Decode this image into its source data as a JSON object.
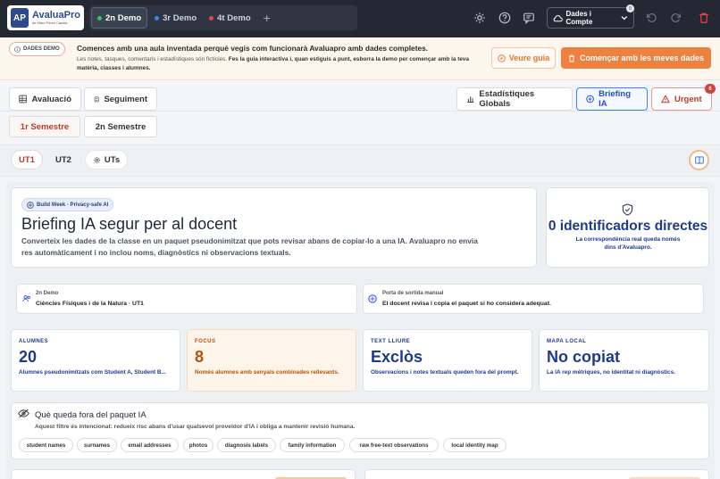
{
  "app": {
    "logo_name": "AvaluaPro",
    "logo_sub": "de Marc Pérez Casals",
    "logo_mark": "AP"
  },
  "demo_tabs": [
    {
      "label": "2n Demo",
      "color": "#34c46a",
      "active": true
    },
    {
      "label": "3r Demo",
      "color": "#3b82f6",
      "active": false
    },
    {
      "label": "4t Demo",
      "color": "#ef4444",
      "active": false
    }
  ],
  "topbar": {
    "account_label": "Dades i Compte",
    "account_badge": "0"
  },
  "banner": {
    "pill": "DADES DEMO",
    "title": "Comences amb una aula inventada perquè vegis com funcionarà Avaluapro amb dades completes.",
    "text_before": "Les notes, tasques, comentaris i estadístiques són fictícies. ",
    "text_bold": "Fes la guia interactiva i, quan estiguis a punt, esborra la demo per començar amb la teva matèria, classes i alumnes.",
    "guide_label": "Veure guia",
    "start_label": "Començar amb les meves dades"
  },
  "section_tabs": {
    "avaluacio": "Avaluació",
    "seguiment": "Seguiment",
    "estadistiques": "Estadístiques Globals",
    "briefing": "Briefing IA",
    "urgent": "Urgent",
    "urgent_count": "6"
  },
  "semesters": [
    "1r Semestre",
    "2n Semestre"
  ],
  "units": {
    "ut1": "UT1",
    "ut2": "UT2",
    "uts": "UTs"
  },
  "briefing": {
    "pill": "Build Week · Privacy-safe AI",
    "title": "Briefing IA segur per al docent",
    "subtitle": "Converteix les dades de la classe en un paquet pseudonimitzat que pots revisar abans de copiar-lo a una IA. Avaluapro no envia res automàticament i no inclou noms, diagnòstics ni observacions textuals.",
    "zero_value": "0 identificadors directes",
    "zero_sub": "La correspondència real queda només dins d'Avaluapro."
  },
  "context": {
    "class_small": "2n Demo",
    "class_main": "Ciències Físiques i de la Natura · UT1",
    "gate_small": "Porta de sortida manual",
    "gate_main": "El docent revisa i copia el paquet si ho considera adequat."
  },
  "stats": [
    {
      "label": "ALUMNES",
      "value": "20",
      "desc": "Alumnes pseudonimitzats com Student A, Student B..."
    },
    {
      "label": "FOCUS",
      "value": "8",
      "desc": "Només alumnes amb senyals combinades rellevants."
    },
    {
      "label": "TEXT LLIURE",
      "value": "Exclòs",
      "desc": "Observacions i notes textuals queden fora del prompt."
    },
    {
      "label": "MAPA LOCAL",
      "value": "No copiat",
      "desc": "La IA rep mètriques, no identitat ni diagnòstics."
    }
  ],
  "excluded": {
    "title": "Què queda fora del paquet IA",
    "subtitle": "Aquest filtre és intencionat: redueix risc abans d'usar qualsevol proveïdor d'IA i obliga a mantenir revisió humana.",
    "chips": [
      "student names",
      "surnames",
      "email addresses",
      "photos",
      "diagnosis labels",
      "family information",
      "raw free-text observations",
      "local identity map"
    ]
  },
  "colors": {
    "accent_orange": "#ec8140",
    "accent_blue": "#1d4ed8",
    "urgent_red": "#c0392b"
  }
}
